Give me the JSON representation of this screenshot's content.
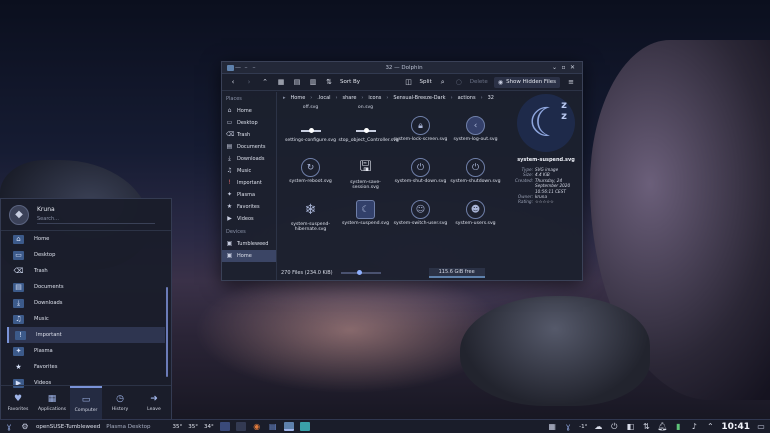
{
  "dolphin": {
    "title": "32 — Dolphin",
    "toolbar": {
      "sort": "Sort By",
      "split": "Split",
      "delete": "Delete",
      "show_hidden": "Show Hidden Files"
    },
    "places": {
      "section": "Places",
      "items": [
        "Home",
        "Desktop",
        "Trash",
        "Documents",
        "Downloads",
        "Music",
        "Important",
        "Plasma",
        "Favorites",
        "Videos"
      ],
      "devices_section": "Devices",
      "devices": [
        "Tumbleweed",
        "Home"
      ]
    },
    "breadcrumb": [
      "Home",
      ".local",
      "share",
      "icons",
      "Sensual-Breeze-Dark",
      "actions",
      "32"
    ],
    "top_partial": [
      "off.svg",
      "on.svg"
    ],
    "files": [
      [
        "settings-configure.svg",
        "stop_object_Controller.svg",
        "system-lock-screen.svg",
        "system-log-out.svg"
      ],
      [
        "system-reboot.svg",
        "system-save-session.svg",
        "system-shut-down.svg",
        "system-shutdown.svg"
      ],
      [
        "system-suspend-hibernate.svg",
        "system-suspend.svg",
        "system-switch-user.svg",
        "system-users.svg"
      ]
    ],
    "preview": {
      "name": "system-suspend.svg",
      "meta": [
        {
          "k": "Type:",
          "v": "SVG image"
        },
        {
          "k": "Size:",
          "v": "4.4 KiB"
        },
        {
          "k": "Created:",
          "v": "Thursday, 24 September 2020 10:56:11 CEST"
        },
        {
          "k": "Owner:",
          "v": "kruna"
        },
        {
          "k": "Rating:",
          "v": "☆☆☆☆☆"
        }
      ]
    },
    "status": {
      "count": "270 Files (234.0 KiB)",
      "free": "115.6 GiB free"
    }
  },
  "launcher": {
    "user": "Kruna",
    "search_placeholder": "Search...",
    "items": [
      "Home",
      "Desktop",
      "Trash",
      "Documents",
      "Downloads",
      "Music",
      "Important",
      "Plasma",
      "Favorites",
      "Videos"
    ],
    "tabs": [
      "Favorites",
      "Applications",
      "Computer",
      "History",
      "Leave"
    ]
  },
  "taskbar": {
    "os": "openSUSE-Tumbleweed",
    "desktop": "Plasma Desktop",
    "temps": [
      "35°",
      "35°",
      "34°"
    ],
    "weather": "-1°",
    "clock": "10:41"
  },
  "colors": {
    "accent": "#7a93d8",
    "panel": "#1a1d2a"
  }
}
